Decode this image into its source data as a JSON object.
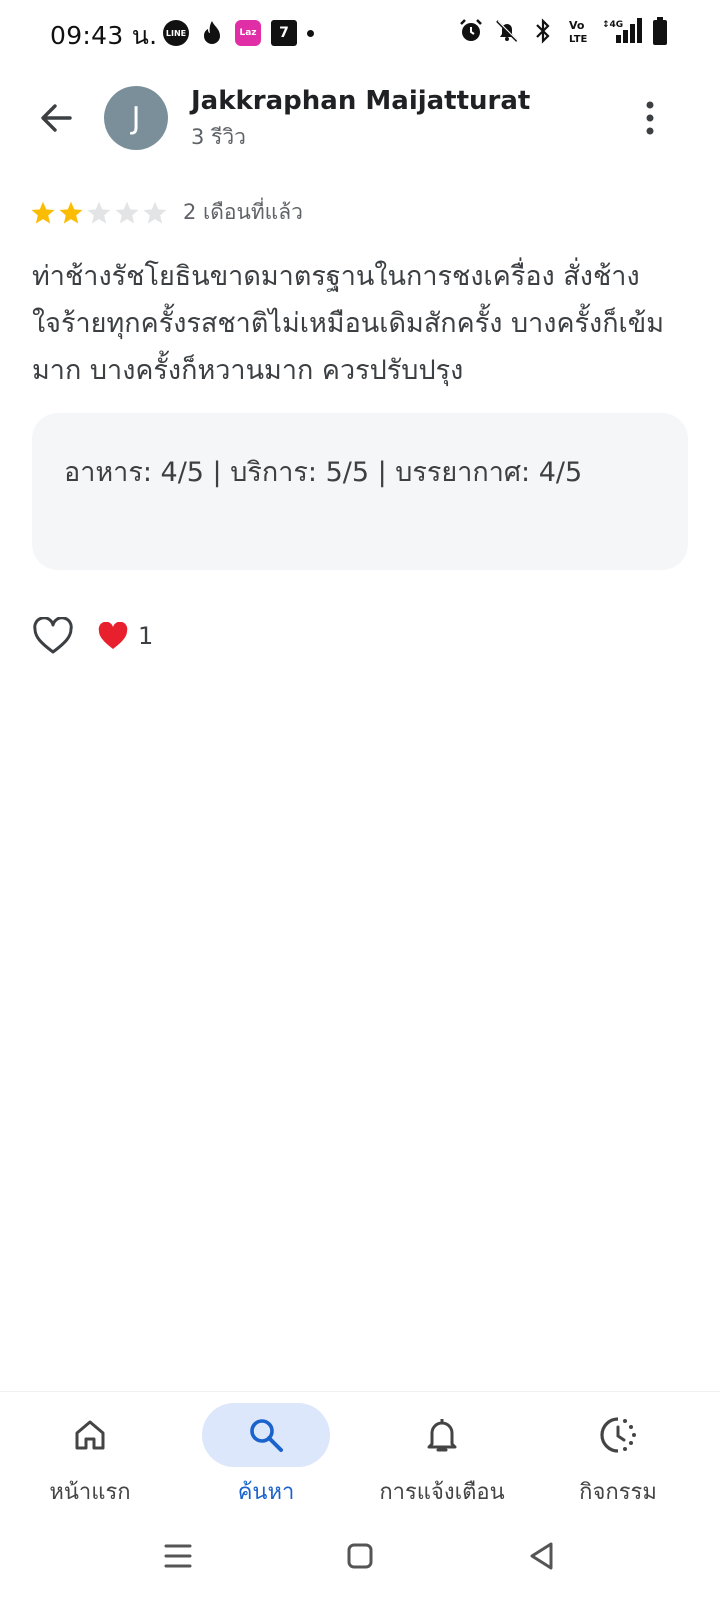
{
  "status_bar": {
    "time": "09:43 น.",
    "apps": [
      {
        "icon": "line-app-icon",
        "text": "LINE"
      },
      {
        "icon": "tinder-app-icon",
        "text": ""
      },
      {
        "icon": "lazada-app-icon",
        "text": "Laz"
      },
      {
        "icon": "seven-eleven-app-icon",
        "text": "7"
      }
    ],
    "indicators": [
      "alarm-icon",
      "mute-icon",
      "bluetooth-icon",
      "volte-icon",
      "4g-signal-icon",
      "battery-icon"
    ]
  },
  "header": {
    "back_icon": "arrow-back-icon",
    "avatar_initial": "J",
    "reviewer_name": "Jakkraphan Maijatturat",
    "review_count": "3 รีวิว",
    "more_icon": "more-vert-icon"
  },
  "review": {
    "rating": 2,
    "max_rating": 5,
    "star_color": "#fbbc04",
    "date": "2 เดือนที่แล้ว",
    "text": "ท่าช้างรัชโยธินขาดมาตรฐานในการชงเครื่อง สั่งช้างใจร้ายทุกครั้งรสชาติไม่เหมือนเดิมสักครั้ง บางครั้งก็เข้มมาก บางครั้งก็หวานมาก ควรปรับปรุง",
    "sub_ratings": "อาหาร: 4/5  |  บริการ: 5/5  |  บรรยากาศ: 4/5"
  },
  "reactions": {
    "like_icon": "heart-outline-icon",
    "heart_icon": "red-heart-icon",
    "heart_count": "1"
  },
  "bottom_nav": {
    "accent_color": "#1a62cc",
    "items": [
      {
        "label": "หน้าแรก",
        "icon": "home-icon",
        "active": false
      },
      {
        "label": "ค้นหา",
        "icon": "search-icon",
        "active": true
      },
      {
        "label": "การแจ้งเตือน",
        "icon": "bell-icon",
        "active": false
      },
      {
        "label": "กิจกรรม",
        "icon": "activity-history-icon",
        "active": false
      }
    ]
  },
  "system_nav": [
    "recents-icon",
    "home-square-icon",
    "back-triangle-icon"
  ]
}
